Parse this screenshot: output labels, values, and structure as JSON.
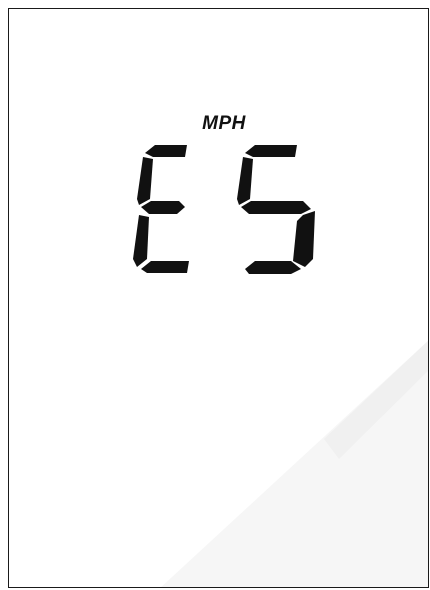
{
  "display": {
    "unit": "MPH",
    "readout": "E5",
    "digit1": "E",
    "digit2": "5"
  },
  "colors": {
    "segment": "#111111",
    "background": "#ffffff",
    "border": "#1a1a1a",
    "watermark": "#f6f6f6"
  }
}
